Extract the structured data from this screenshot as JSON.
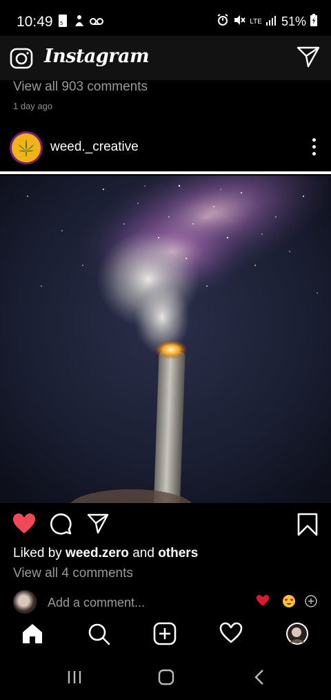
{
  "status": {
    "time": "10:49",
    "lte": "LTE",
    "battery": "51%"
  },
  "app": {
    "title": "Instagram"
  },
  "previous_post": {
    "view_comments": "View all 903 comments",
    "time_ago": "1 day ago"
  },
  "post": {
    "username": "weed._creative",
    "liked_by_prefix": "Liked by ",
    "liked_by_user": "weed.zero",
    "liked_by_mid": " and ",
    "liked_by_others": "others",
    "view_comments": "View all 4 comments",
    "comment_placeholder": "Add a comment..."
  },
  "colors": {
    "like": "#ed4956",
    "background": "#000000",
    "header": "#121212",
    "secondary_text": "#9a9a9a"
  },
  "icons": [
    "camera-icon",
    "direct-message-icon",
    "more-icon",
    "heart-icon",
    "comment-icon",
    "share-icon",
    "bookmark-icon",
    "home-icon",
    "search-icon",
    "new-post-icon",
    "activity-icon",
    "profile-icon",
    "recents-icon",
    "android-home-icon",
    "back-icon"
  ]
}
